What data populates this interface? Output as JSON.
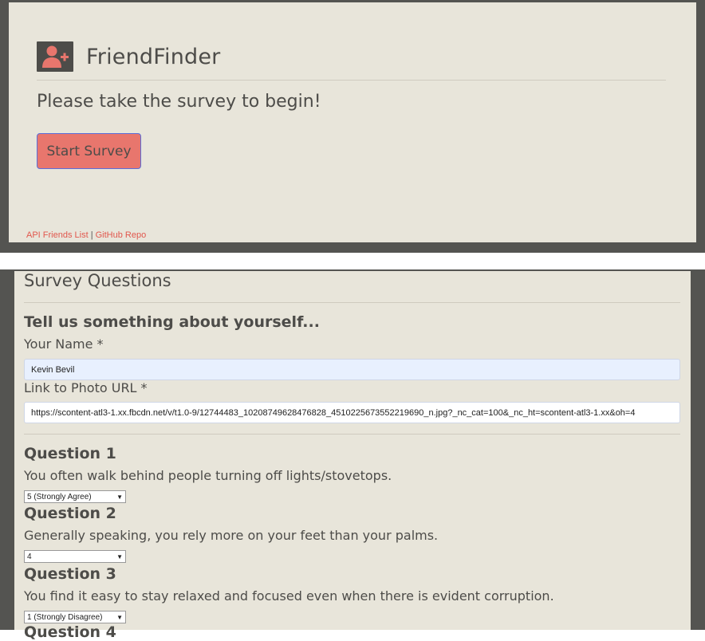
{
  "header": {
    "app_title": "FriendFinder",
    "icon": "user-plus-icon",
    "tagline": "Please take the survey to begin!",
    "start_button": "Start Survey",
    "footer": {
      "link_api": "API Friends List",
      "separator": "|",
      "link_github": "GitHub Repo"
    }
  },
  "survey": {
    "heading": "Survey Questions",
    "section_title": "Tell us something about yourself...",
    "name_label": "Your Name *",
    "name_value": "Kevin Bevil",
    "photo_label": "Link to Photo URL *",
    "photo_value": "https://scontent-atl3-1.xx.fbcdn.net/v/t1.0-9/12744483_10208749628476828_4510225673552219690_n.jpg?_nc_cat=100&_nc_ht=scontent-atl3-1.xx&oh=4",
    "questions": [
      {
        "title": "Question 1",
        "text": "You often walk behind people turning off lights/stovetops.",
        "selected": "5 (Strongly Agree)"
      },
      {
        "title": "Question 2",
        "text": "Generally speaking, you rely more on your feet than your palms.",
        "selected": "4"
      },
      {
        "title": "Question 3",
        "text": "You find it easy to stay relaxed and focused even when there is evident corruption.",
        "selected": "1 (Strongly Disagree)"
      },
      {
        "title": "Question 4"
      }
    ]
  },
  "colors": {
    "panel_bg": "#e8e5da",
    "frame": "#545451",
    "accent": "#e8766d",
    "link": "#e1574d"
  }
}
